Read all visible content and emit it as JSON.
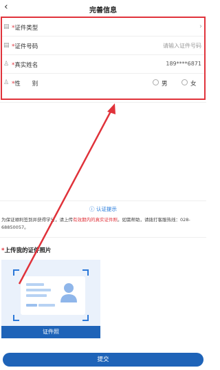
{
  "header": {
    "title": "完善信息",
    "back_icon": "chevron-left-icon"
  },
  "form": {
    "required_mark": "*",
    "cert_type": {
      "label": "证件类型",
      "icon": "id-card-icon"
    },
    "cert_number": {
      "label": "证件号码",
      "placeholder": "请输入证件号码",
      "icon": "id-card-icon"
    },
    "real_name": {
      "label": "真实姓名",
      "value": "189****6871",
      "icon": "person-icon"
    },
    "gender": {
      "label": "性　　别",
      "options": [
        "男",
        "女"
      ],
      "icon": "person-icon"
    }
  },
  "tip": {
    "title": "认证提示",
    "text_before": "为保证顺利签到并获得学分，请上传",
    "text_highlight": "有效期内的真实证件照",
    "text_after": "。如需帮助，请拨打客服热线：028-68850057。"
  },
  "upload": {
    "title": "上传我的证件照片",
    "button_label": "证件照"
  },
  "submit_label": "提交",
  "colors": {
    "accent": "#1e63b8",
    "annotation_red": "#e0323a",
    "link_blue": "#1a73d9"
  }
}
